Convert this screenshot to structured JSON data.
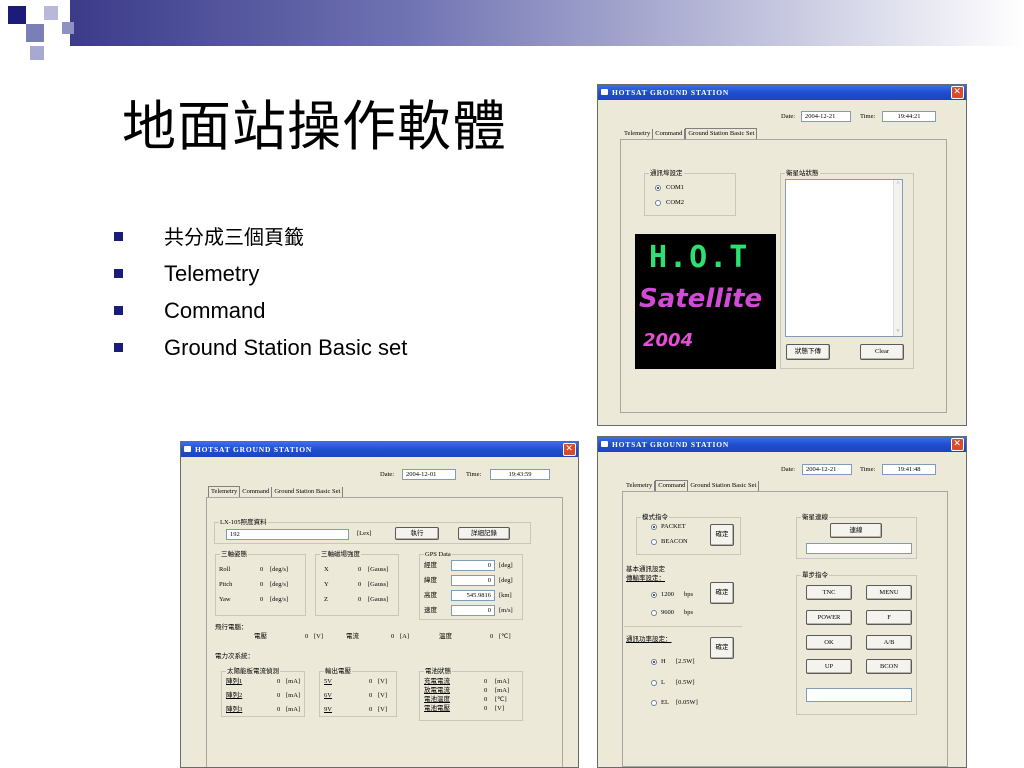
{
  "slide": {
    "title": "地面站操作軟體",
    "bullets": [
      "共分成三個頁籤",
      "Telemetry",
      "Command",
      "Ground Station Basic set"
    ],
    "accent_color": "#1b1b7a"
  },
  "window_common": {
    "title": "HOTSAT GROUND STATION",
    "close_glyph": "✕",
    "date_label": "Date:",
    "time_label": "Time:",
    "tab_telemetry": "Telemetry",
    "tab_command": "Command",
    "tab_basic": "Ground Station Basic Set"
  },
  "win_basic": {
    "date": "2004-12-21",
    "time": "19:44:21",
    "comm_group": "通訊埠設定",
    "com1": "COM1",
    "com2": "COM2",
    "status_group": "衛星站狀態",
    "download_button": "狀態下傳",
    "clear_button": "Clear",
    "logo_line1": "H.O.T",
    "logo_line2": "Satellite",
    "logo_line3": "2004"
  },
  "win_telemetry": {
    "date": "2004-12-01",
    "time": "19:43:59",
    "lx_group": "LX-105照度資料",
    "lx_value": "192",
    "lx_unit": "[Lex]",
    "exec_button": "執行",
    "detail_button": "詳細記錄",
    "attitude": {
      "group": "三軸姿態",
      "rows": [
        {
          "label": "Roll",
          "value": "0",
          "unit": "[deg/s]"
        },
        {
          "label": "Pitch",
          "value": "0",
          "unit": "[deg/s]"
        },
        {
          "label": "Yaw",
          "value": "0",
          "unit": "[deg/s]"
        }
      ]
    },
    "magnet": {
      "group": "三軸磁場強度",
      "rows": [
        {
          "label": "X",
          "value": "0",
          "unit": "[Gauss]"
        },
        {
          "label": "Y",
          "value": "0",
          "unit": "[Gauss]"
        },
        {
          "label": "Z",
          "value": "0",
          "unit": "[Gauss]"
        }
      ]
    },
    "gps": {
      "group": "GPS Data",
      "rows": [
        {
          "label": "經度",
          "value": "0",
          "unit": "[deg]"
        },
        {
          "label": "緯度",
          "value": "0",
          "unit": "[deg]"
        },
        {
          "label": "高度",
          "value": "545.9816",
          "unit": "[km]"
        },
        {
          "label": "速度",
          "value": "0",
          "unit": "[m/s]"
        }
      ]
    },
    "flight_computer": {
      "label": "飛行電腦：",
      "voltage_label": "電壓",
      "voltage_value": "0",
      "voltage_unit": "[V]",
      "current_label": "電流",
      "current_value": "0",
      "current_unit": "[A]",
      "temp_label": "溫度",
      "temp_value": "0",
      "temp_unit": "[℃]"
    },
    "power": {
      "label": "電力次系統：",
      "solar_group": "太陽能板電流偵測",
      "solar_rows": [
        {
          "label": "陣列1",
          "value": "0",
          "unit": "[mA]"
        },
        {
          "label": "陣列2",
          "value": "0",
          "unit": "[mA]"
        },
        {
          "label": "陣列3",
          "value": "0",
          "unit": "[mA]"
        }
      ],
      "out_group": "輸出電壓",
      "out_rows": [
        {
          "label": "5V",
          "value": "0",
          "unit": "[V]"
        },
        {
          "label": "6V",
          "value": "0",
          "unit": "[V]"
        },
        {
          "label": "9V",
          "value": "0",
          "unit": "[V]"
        }
      ],
      "battery_group": "電池狀態",
      "battery_rows": [
        {
          "label": "充電電流",
          "value": "0",
          "unit": "[mA]"
        },
        {
          "label": "放電電流",
          "value": "0",
          "unit": "[mA]"
        },
        {
          "label": "電池溫度",
          "value": "0",
          "unit": "[℃]"
        },
        {
          "label": "電池電壓",
          "value": "0",
          "unit": "[V]"
        }
      ]
    }
  },
  "win_command": {
    "date": "2004-12-21",
    "time": "19:41:48",
    "mode_group": "模式指令",
    "packet": "PACKET",
    "beacon": "BEACON",
    "confirm": "確定",
    "basic_group": "基本通訊設定",
    "baud_label": "傳輸率設定：",
    "baud_1200": "1200",
    "baud_9600": "9600",
    "bps": "bps",
    "power_label": "通訊功率設定：",
    "power_h": "H",
    "power_h_val": "[2.5W]",
    "power_l": "L",
    "power_l_val": "[0.5W]",
    "power_el": "EL",
    "power_el_val": "[0.05W]",
    "link_group": "衛星連線",
    "link_button": "連線",
    "step_group": "單步指令",
    "step_buttons": [
      "TNC",
      "MENU",
      "POWER",
      "F",
      "OK",
      "A/B",
      "UP",
      "BCON"
    ]
  }
}
